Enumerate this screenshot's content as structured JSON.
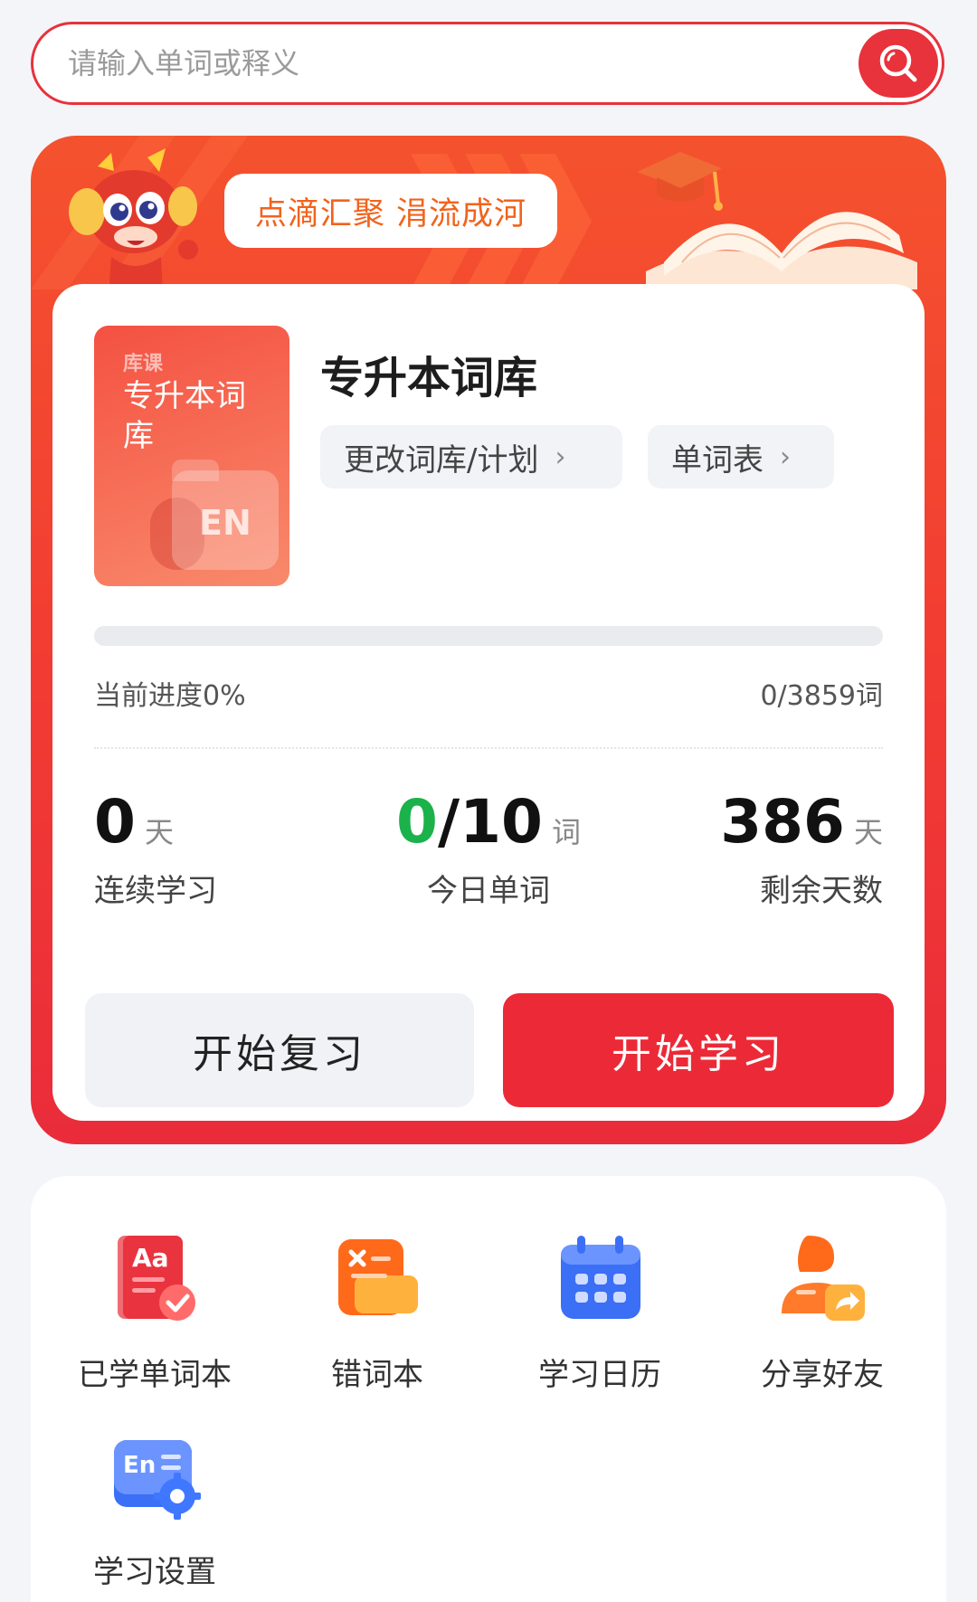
{
  "search": {
    "placeholder": "请输入单词或释义"
  },
  "banner": {
    "slogan": "点滴汇聚 涓流成河"
  },
  "library": {
    "cover_brand": "库课",
    "cover_title": "专升本词库",
    "cover_badge": "EN",
    "title": "专升本词库",
    "change_label": "更改词库/计划",
    "wordlist_label": "单词表",
    "chevron": "›"
  },
  "progress": {
    "label": "当前进度0%",
    "count": "0/3859词",
    "fraction": 0
  },
  "stats": {
    "streak": {
      "value": "0",
      "unit": "天",
      "label": "连续学习"
    },
    "today": {
      "done": "0",
      "total": "/10",
      "unit": "词",
      "label": "今日单词"
    },
    "remaining": {
      "value": "386",
      "unit": "天",
      "label": "剩余天数"
    }
  },
  "actions": {
    "review": "开始复习",
    "study": "开始学习"
  },
  "tools": [
    {
      "label": "已学单词本",
      "icon": "learned-book-icon"
    },
    {
      "label": "错词本",
      "icon": "wrong-words-icon"
    },
    {
      "label": "学习日历",
      "icon": "calendar-icon"
    },
    {
      "label": "分享好友",
      "icon": "share-friend-icon"
    },
    {
      "label": "学习设置",
      "icon": "study-settings-icon"
    }
  ],
  "colors": {
    "brand_red": "#ec2a37",
    "accent_orange": "#f2631c",
    "done_green": "#1bb24b"
  }
}
